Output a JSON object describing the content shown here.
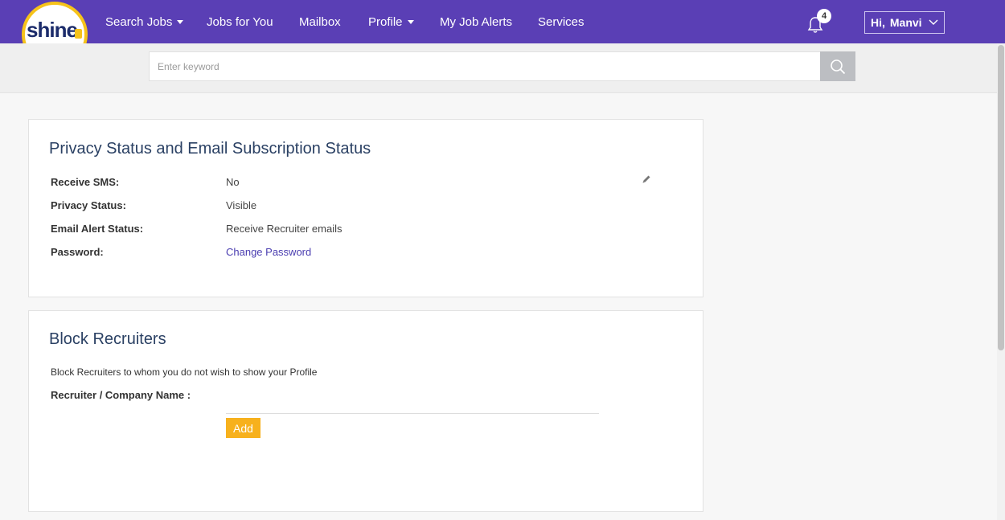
{
  "header": {
    "logo_text": "shine",
    "nav": [
      {
        "label": "Search Jobs",
        "dropdown": true
      },
      {
        "label": "Jobs for You",
        "dropdown": false
      },
      {
        "label": "Mailbox",
        "dropdown": false
      },
      {
        "label": "Profile",
        "dropdown": true
      },
      {
        "label": "My Job Alerts",
        "dropdown": false
      },
      {
        "label": "Services",
        "dropdown": false
      }
    ],
    "notification_count": "4",
    "greeting": "Hi,",
    "user_name": "Manvi",
    "brand_color": "#5a3fb5"
  },
  "search": {
    "placeholder": "Enter keyword",
    "value": ""
  },
  "privacy": {
    "title": "Privacy Status and Email Subscription Status",
    "rows": [
      {
        "label": "Receive SMS:",
        "value": "No"
      },
      {
        "label": "Privacy Status:",
        "value": "Visible"
      },
      {
        "label": "Email Alert Status:",
        "value": "Receive Recruiter emails"
      },
      {
        "label": "Password:",
        "value": "Change Password"
      }
    ]
  },
  "block": {
    "title": "Block Recruiters",
    "description": "Block Recruiters to whom you do not wish to show your Profile",
    "field_label": "Recruiter / Company Name :",
    "field_value": "",
    "add_label": "Add",
    "add_color": "#f7b11d"
  }
}
